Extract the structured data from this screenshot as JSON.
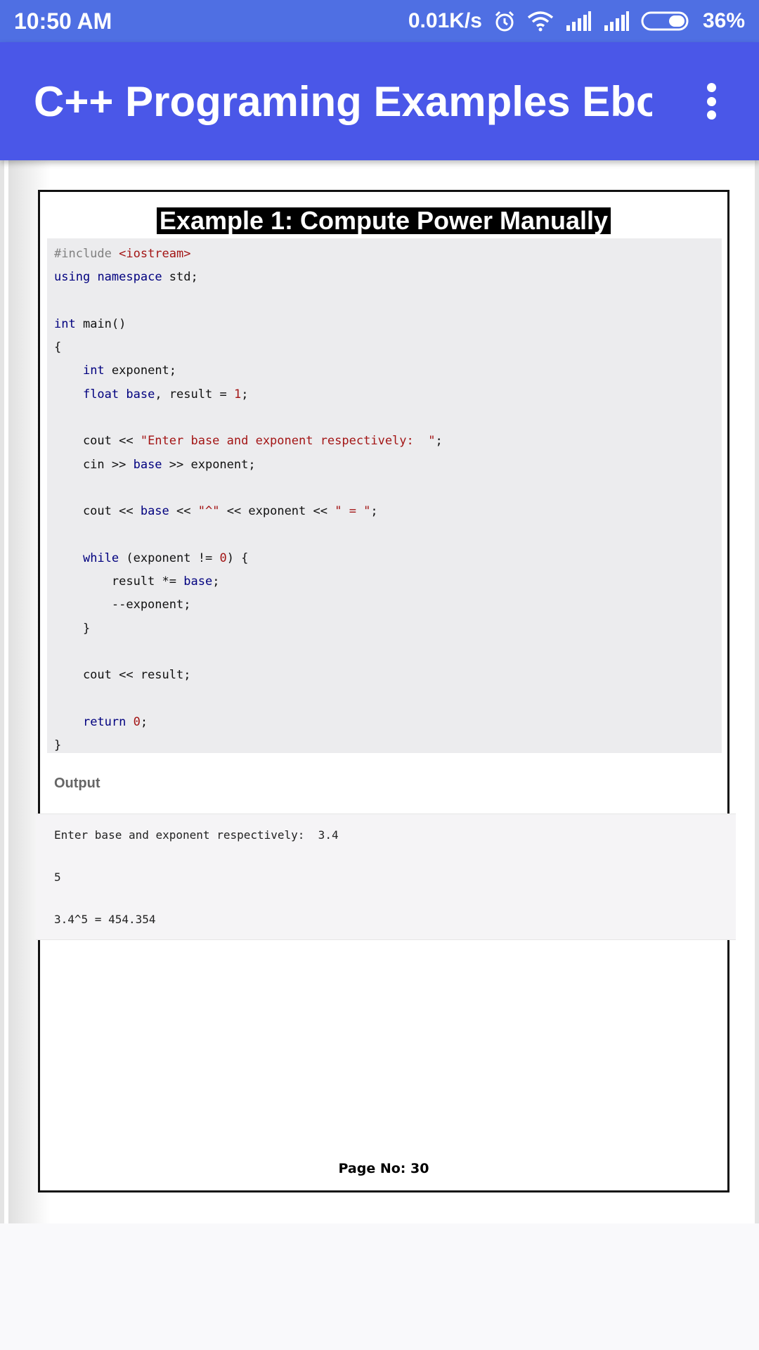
{
  "status_bar": {
    "time": "10:50 AM",
    "net_speed": "0.01K/s",
    "battery": "36%"
  },
  "app_bar": {
    "title": "C++ Programing Examples Ebo…"
  },
  "page": {
    "heading": "Example 1: Compute Power Manually",
    "code_lines": [
      [
        [
          "pre",
          "#include "
        ],
        [
          "str",
          "<iostream>"
        ]
      ],
      [
        [
          "kw",
          "using"
        ],
        [
          "plain",
          " "
        ],
        [
          "kw",
          "namespace"
        ],
        [
          "plain",
          " std;"
        ]
      ],
      [],
      [
        [
          "kw",
          "int"
        ],
        [
          "plain",
          " main()"
        ]
      ],
      [
        [
          "plain",
          "{"
        ]
      ],
      [
        [
          "plain",
          "    "
        ],
        [
          "kw",
          "int"
        ],
        [
          "plain",
          " exponent;"
        ]
      ],
      [
        [
          "plain",
          "    "
        ],
        [
          "kw",
          "float"
        ],
        [
          "plain",
          " "
        ],
        [
          "kw",
          "base"
        ],
        [
          "plain",
          ", result = "
        ],
        [
          "num",
          "1"
        ],
        [
          "plain",
          ";"
        ]
      ],
      [],
      [
        [
          "plain",
          "    cout << "
        ],
        [
          "str",
          "\"Enter base and exponent respectively:  \""
        ],
        [
          "plain",
          ";"
        ]
      ],
      [
        [
          "plain",
          "    cin >> "
        ],
        [
          "kw",
          "base"
        ],
        [
          "plain",
          " >> exponent;"
        ]
      ],
      [],
      [
        [
          "plain",
          "    cout << "
        ],
        [
          "kw",
          "base"
        ],
        [
          "plain",
          " << "
        ],
        [
          "str",
          "\"^\""
        ],
        [
          "plain",
          " << exponent << "
        ],
        [
          "str",
          "\" = \""
        ],
        [
          "plain",
          ";"
        ]
      ],
      [],
      [
        [
          "plain",
          "    "
        ],
        [
          "kw",
          "while"
        ],
        [
          "plain",
          " (exponent != "
        ],
        [
          "num",
          "0"
        ],
        [
          "plain",
          ") {"
        ]
      ],
      [
        [
          "plain",
          "        result *= "
        ],
        [
          "kw",
          "base"
        ],
        [
          "plain",
          ";"
        ]
      ],
      [
        [
          "plain",
          "        --exponent;"
        ]
      ],
      [
        [
          "plain",
          "    }"
        ]
      ],
      [],
      [
        [
          "plain",
          "    cout << result;"
        ]
      ],
      [],
      [
        [
          "plain",
          "    "
        ],
        [
          "kw",
          "return"
        ],
        [
          "plain",
          " "
        ],
        [
          "num",
          "0"
        ],
        [
          "plain",
          ";"
        ]
      ],
      [
        [
          "plain",
          "}"
        ]
      ]
    ],
    "output_label": "Output",
    "output_lines": [
      "Enter base and exponent respectively:  3.4",
      "5",
      "3.4^5 = 454.354"
    ],
    "page_number": "Page No: 30"
  }
}
